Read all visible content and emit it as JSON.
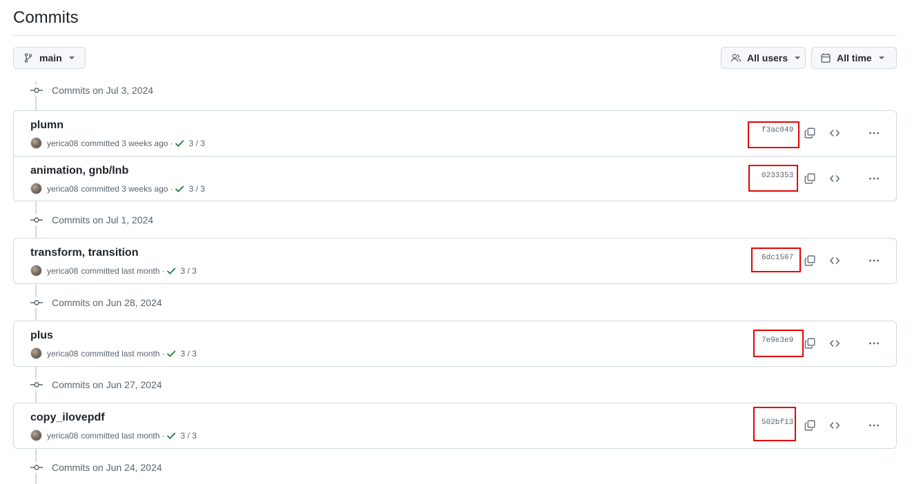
{
  "page": {
    "title": "Commits"
  },
  "toolbar": {
    "branch_label": "main",
    "users_label": "All users",
    "time_label": "All time"
  },
  "groups": [
    {
      "header": "Commits on Jul 3, 2024",
      "commits": [
        {
          "title": "plumn",
          "author": "yerica08",
          "action": "committed",
          "when": "3 weeks ago",
          "checks": "3 / 3",
          "sha": "f3ac049"
        },
        {
          "title": "animation, gnb/lnb",
          "author": "yerica08",
          "action": "committed",
          "when": "3 weeks ago",
          "checks": "3 / 3",
          "sha": "0233353"
        }
      ]
    },
    {
      "header": "Commits on Jul 1, 2024",
      "commits": [
        {
          "title": "transform, transition",
          "author": "yerica08",
          "action": "committed",
          "when": "last month",
          "checks": "3 / 3",
          "sha": "6dc1567"
        }
      ]
    },
    {
      "header": "Commits on Jun 28, 2024",
      "commits": [
        {
          "title": "plus",
          "author": "yerica08",
          "action": "committed",
          "when": "last month",
          "checks": "3 / 3",
          "sha": "7e9e3e9"
        }
      ]
    },
    {
      "header": "Commits on Jun 27, 2024",
      "commits": [
        {
          "title": "copy_ilovepdf",
          "author": "yerica08",
          "action": "committed",
          "when": "last month",
          "checks": "3 / 3",
          "sha": "502bf13"
        }
      ]
    },
    {
      "header": "Commits on Jun 24, 2024",
      "commits": []
    }
  ],
  "colors": {
    "check": "#1a7f37",
    "highlight": "#e50000",
    "muted": "#59636e"
  },
  "icons": {
    "branch": "git-branch-icon",
    "users": "people-icon",
    "time": "calendar-icon",
    "timeline_node": "git-commit-icon",
    "status": "check-icon",
    "copy": "copy-icon",
    "browse": "code-icon",
    "more": "kebab-horizontal-icon"
  }
}
